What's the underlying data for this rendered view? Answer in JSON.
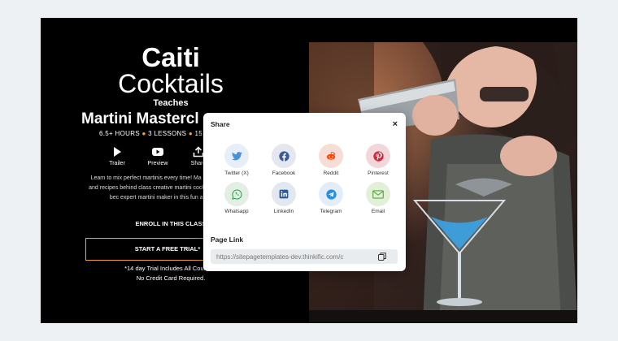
{
  "course": {
    "title_line1": "Caiti",
    "title_line2": "Cocktails",
    "teaches": "Teaches",
    "course_name": "Martini Mastercl",
    "meta_hours": "6.5+ HOURS",
    "meta_lessons": "3 LESSONS",
    "meta_recipes": "15 RECI",
    "bullet": "●",
    "description": "Learn to mix perfect martinis every time! Ma history, techniques, and recipes behind class creative martini cocktails. Shake or stir - bec expert martini maker in this fun and informati"
  },
  "actions": [
    {
      "label": "Trailer",
      "icon": "play-icon"
    },
    {
      "label": "Preview",
      "icon": "youtube-icon"
    },
    {
      "label": "Share",
      "icon": "share-icon"
    }
  ],
  "cta": {
    "enroll": "ENROLL IN THIS CLASS",
    "trial_button": "START A FREE TRIAL*",
    "note_line1": "*14 day Trial Includes All Courses.",
    "note_line2": "No Credit Card Required."
  },
  "share_modal": {
    "title": "Share",
    "close": "×",
    "page_link_label": "Page Link",
    "url": "https://sitepagetemplates-dev.thinkific.com/c",
    "options": [
      {
        "label": "Twitter (X)",
        "icon": "twitter-icon",
        "bg": "#e6eef8",
        "color": "#4a90d9"
      },
      {
        "label": "Facebook",
        "icon": "facebook-icon",
        "bg": "#e4e7ef",
        "color": "#3b5998"
      },
      {
        "label": "Reddit",
        "icon": "reddit-icon",
        "bg": "#f6ddd6",
        "color": "#ff4500"
      },
      {
        "label": "Pinterest",
        "icon": "pinterest-icon",
        "bg": "#f3d6da",
        "color": "#d6223a"
      },
      {
        "label": "Whatsapp",
        "icon": "whatsapp-icon",
        "bg": "#e3efe5",
        "color": "#25a244"
      },
      {
        "label": "LinkedIn",
        "icon": "linkedin-icon",
        "bg": "#e2e8f0",
        "color": "#2a5aa0"
      },
      {
        "label": "Telegram",
        "icon": "telegram-icon",
        "bg": "#e3edf8",
        "color": "#2f8fd6"
      },
      {
        "label": "Email",
        "icon": "email-icon",
        "bg": "#e2f0d9",
        "color": "#5aa83a"
      }
    ]
  },
  "colors": {
    "accent": "#f5a623",
    "background": "#000000",
    "page": "#eef1f3"
  }
}
